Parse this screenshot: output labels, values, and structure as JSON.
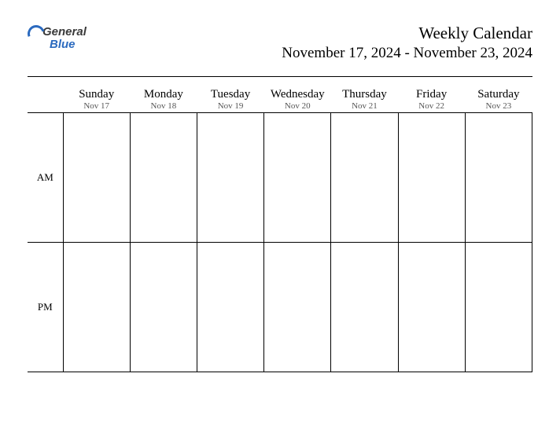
{
  "logo": {
    "line1": "General",
    "line2": "Blue"
  },
  "title": "Weekly Calendar",
  "date_range": "November 17, 2024 - November 23, 2024",
  "days": [
    {
      "name": "Sunday",
      "date": "Nov 17"
    },
    {
      "name": "Monday",
      "date": "Nov 18"
    },
    {
      "name": "Tuesday",
      "date": "Nov 19"
    },
    {
      "name": "Wednesday",
      "date": "Nov 20"
    },
    {
      "name": "Thursday",
      "date": "Nov 21"
    },
    {
      "name": "Friday",
      "date": "Nov 22"
    },
    {
      "name": "Saturday",
      "date": "Nov 23"
    }
  ],
  "periods": {
    "am": "AM",
    "pm": "PM"
  }
}
